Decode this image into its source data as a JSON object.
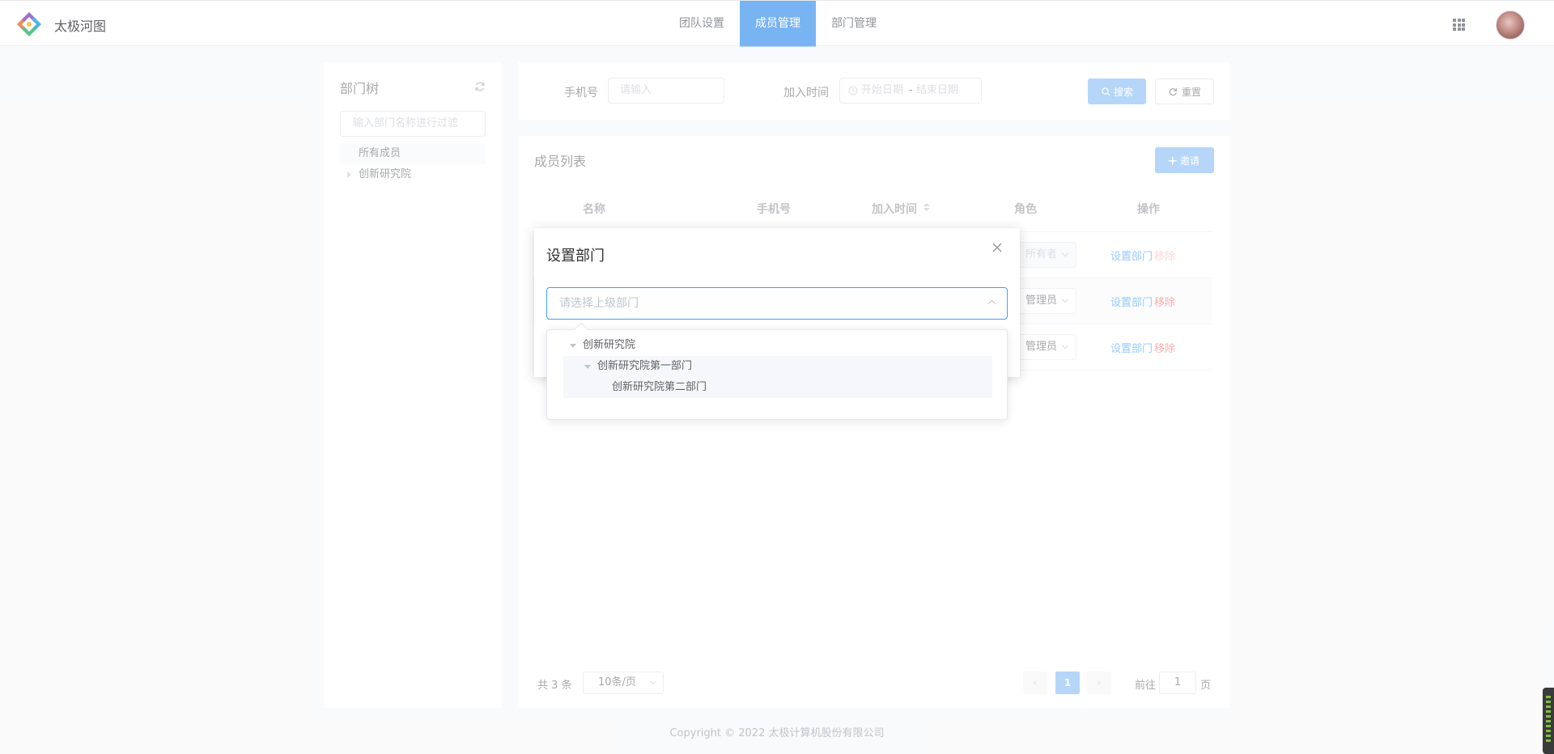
{
  "header": {
    "brand": "太极河图",
    "tabs": [
      {
        "label": "团队设置",
        "active": false
      },
      {
        "label": "成员管理",
        "active": true
      },
      {
        "label": "部门管理",
        "active": false
      }
    ],
    "apps_icon": "grid-icon",
    "accent_color": "#79b4f2"
  },
  "dept_tree": {
    "title": "部门树",
    "filter_placeholder": "输入部门名称进行过滤",
    "items": [
      "所有成员",
      "创新研究院"
    ]
  },
  "search": {
    "phone_label": "手机号",
    "phone_placeholder": "请输入",
    "join_label": "加入时间",
    "date_start_placeholder": "开始日期",
    "date_sep": "-",
    "date_end_placeholder": "结束日期",
    "search_button": "搜索",
    "reset_button": "重置"
  },
  "member_list": {
    "title": "成员列表",
    "invite_button": "邀请",
    "columns": [
      "名称",
      "手机号",
      "加入时间",
      "角色",
      "操作"
    ],
    "rows": [
      {
        "role": "所有者",
        "set_dept": "设置部门",
        "remove": "移除",
        "disabled": true
      },
      {
        "role": "管理员",
        "set_dept": "设置部门",
        "remove": "移除",
        "disabled": false
      },
      {
        "role": "管理员",
        "set_dept": "设置部门",
        "remove": "移除",
        "disabled": false
      }
    ]
  },
  "pagination": {
    "total": "共 3 条",
    "page_size": "10条/页",
    "current": "1",
    "goto_label": "前往",
    "goto_value": "1",
    "page_suffix": "页"
  },
  "footer": {
    "copyright": "Copyright © 2022 太极计算机股份有限公司"
  },
  "dialog": {
    "title": "设置部门",
    "select_placeholder": "请选择上级部门",
    "options": [
      "创新研究院",
      "创新研究院第一部门",
      "创新研究院第二部门"
    ]
  }
}
